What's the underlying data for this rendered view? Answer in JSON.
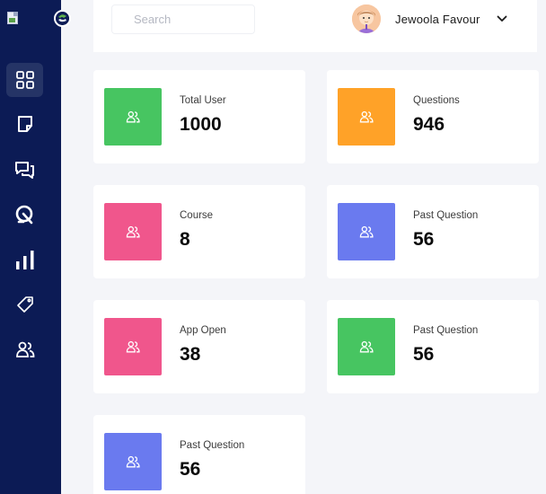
{
  "brand": {
    "logo_icon": "broken-image-icon",
    "emblem_icon": "app-emblem-icon"
  },
  "sidebar": {
    "items": [
      {
        "icon": "dashboard-grid-icon",
        "active": true
      },
      {
        "icon": "note-icon",
        "active": false
      },
      {
        "icon": "chat-icon",
        "active": false
      },
      {
        "icon": "quiz-icon",
        "active": false
      },
      {
        "icon": "bar-chart-icon",
        "active": false
      },
      {
        "icon": "tag-icon",
        "active": false
      },
      {
        "icon": "users-icon",
        "active": false
      }
    ]
  },
  "topbar": {
    "search_placeholder": "Search",
    "user_name": "Jewoola Favour"
  },
  "colors": {
    "sidebar": "#0c1b55",
    "green": "#47c561",
    "orange": "#ffa228",
    "pink": "#f0568c",
    "indigo": "#6a7aef"
  },
  "stats": [
    {
      "label": "Total User",
      "value": "1000",
      "color": "#47c561"
    },
    {
      "label": "Questions",
      "value": "946",
      "color": "#ffa228"
    },
    {
      "label": "Course",
      "value": "8",
      "color": "#f0568c"
    },
    {
      "label": "Past Question",
      "value": "56",
      "color": "#6a7aef"
    },
    {
      "label": "App Open",
      "value": "38",
      "color": "#f0568c"
    },
    {
      "label": "Past Question",
      "value": "56",
      "color": "#47c561"
    },
    {
      "label": "Past Question",
      "value": "56",
      "color": "#6a7aef"
    }
  ]
}
